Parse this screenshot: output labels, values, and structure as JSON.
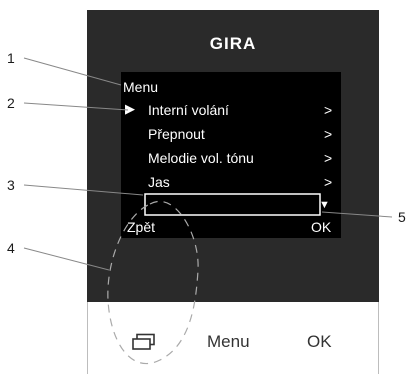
{
  "device": {
    "brand": "GIRA",
    "screen": {
      "title": "Menu",
      "selected_marker": "▶",
      "items": [
        {
          "label": "Interní volání",
          "arrow": ">"
        },
        {
          "label": "Přepnout",
          "arrow": ">"
        },
        {
          "label": "Melodie vol. tónu",
          "arrow": ">"
        },
        {
          "label": "Jas",
          "arrow": ">"
        }
      ],
      "down_marker": "▼",
      "soft_left": "Zpět",
      "soft_right": "OK"
    },
    "buttons": {
      "left_icon": "switch-screens-icon",
      "menu_label": "Menu",
      "ok_label": "OK"
    }
  },
  "callouts": [
    "1",
    "2",
    "3",
    "4",
    "5"
  ],
  "colors": {
    "housing": "#2a2a2a",
    "screen": "#000000",
    "screen_text": "#ffffff",
    "callout_line": "#888888"
  }
}
